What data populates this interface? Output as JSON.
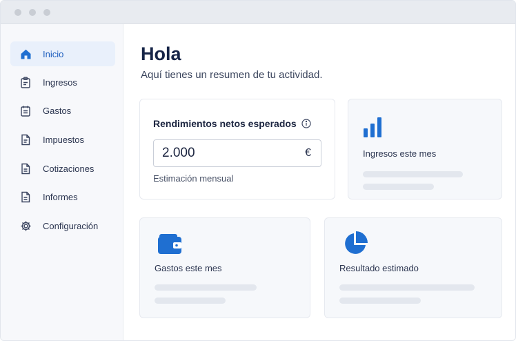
{
  "sidebar": {
    "items": [
      {
        "label": "Inicio",
        "icon": "home-icon",
        "active": true
      },
      {
        "label": "Ingresos",
        "icon": "clipboard-icon"
      },
      {
        "label": "Gastos",
        "icon": "receipt-icon"
      },
      {
        "label": "Impuestos",
        "icon": "document-icon"
      },
      {
        "label": "Cotizaciones",
        "icon": "document-icon"
      },
      {
        "label": "Informes",
        "icon": "document-icon"
      },
      {
        "label": "Configuración",
        "icon": "gear-icon"
      }
    ]
  },
  "main": {
    "title": "Hola",
    "subtitle": "Aquí tienes un resumen de tu actividad.",
    "rendimientos": {
      "title": "Rendimientos netos esperados",
      "value": "2.000",
      "currency": "€",
      "caption": "Estimación mensual"
    },
    "cards": {
      "ingresos": {
        "label": "Ingresos este mes",
        "icon": "bar-chart-icon"
      },
      "gastos": {
        "label": "Gastos este mes",
        "icon": "wallet-icon"
      },
      "resultado": {
        "label": "Resultado estimado",
        "icon": "pie-chart-icon"
      }
    }
  },
  "colors": {
    "accent": "#1f6fd1",
    "active_bg": "#e9f0fb",
    "icon_stroke": "#3b4560"
  }
}
